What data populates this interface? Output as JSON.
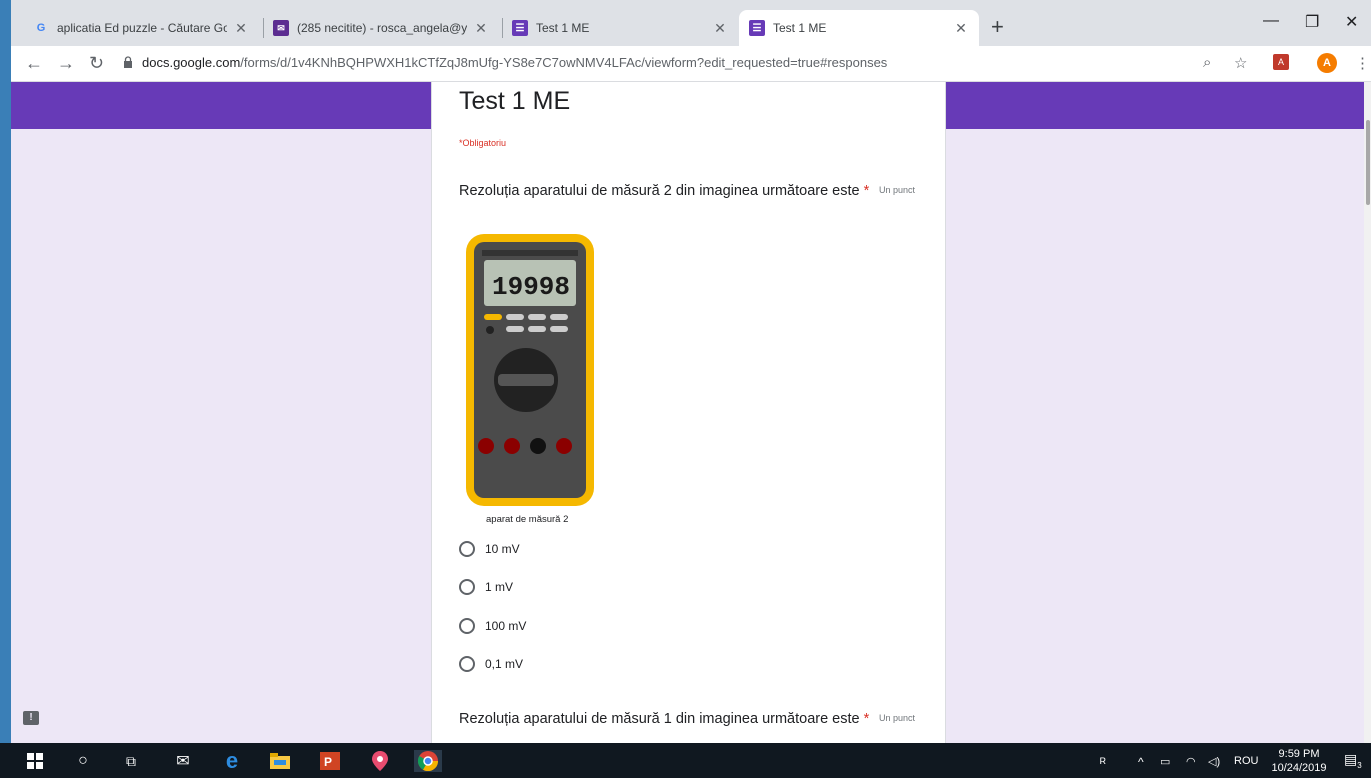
{
  "browser": {
    "tabs": [
      {
        "title": "aplicatia Ed puzzle - Căutare Goo",
        "favicon": "google-icon"
      },
      {
        "title": "(285 necitite) - rosca_angela@ya",
        "favicon": "mail-icon"
      },
      {
        "title": "Test 1 ME",
        "favicon": "forms-icon"
      },
      {
        "title": "Test 1 ME",
        "favicon": "forms-icon",
        "active": true
      }
    ],
    "url_host": "docs.google.com",
    "url_path": "/forms/d/1v4KNhBQHPWXH1kCTfZqJ8mUfg-YS8e7C7owNMV4LFAc/viewform?edit_requested=true#responses",
    "profile_initial": "A"
  },
  "form": {
    "title": "Test 1 ME",
    "required_note": "*Obligatoriu",
    "questions": [
      {
        "text": "Rezoluția aparatului de măsură 2 din imaginea următoare este",
        "required_mark": "*",
        "points": "Un punct",
        "image_caption": "aparat de măsură 2",
        "display_reading": "19998",
        "options": [
          "10 mV",
          "1 mV",
          "100 mV",
          "0,1 mV"
        ]
      },
      {
        "text": "Rezoluția aparatului de măsură 1 din imaginea următoare este",
        "required_mark": "*",
        "points": "Un punct"
      }
    ]
  },
  "taskbar": {
    "language": "ROU",
    "time": "9:59 PM",
    "date": "10/24/2019",
    "notifications": "3"
  },
  "colors": {
    "form_accent": "#673ab7",
    "page_bg": "#ede7f6",
    "required": "#d93025"
  }
}
